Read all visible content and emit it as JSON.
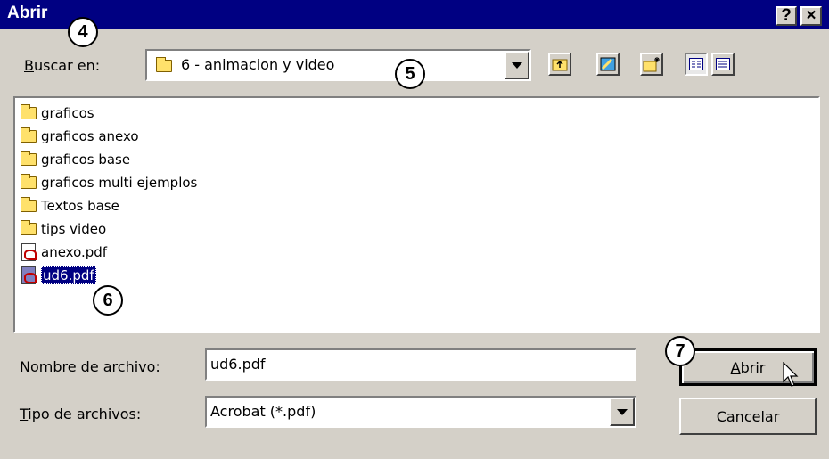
{
  "window": {
    "title": "Abrir",
    "help_label": "?",
    "close_label": "×"
  },
  "look_in": {
    "label_accel": "B",
    "label_rest": "uscar en:",
    "value": "6 - animacion y video"
  },
  "toolbar": {
    "icons": [
      "up-folder-icon",
      "desktop-icon",
      "new-folder-icon",
      "list-view-icon",
      "details-view-icon"
    ]
  },
  "files": [
    {
      "name": "graficos",
      "type": "folder",
      "selected": false
    },
    {
      "name": "graficos anexo",
      "type": "folder",
      "selected": false
    },
    {
      "name": "graficos base",
      "type": "folder",
      "selected": false
    },
    {
      "name": "graficos multi ejemplos",
      "type": "folder",
      "selected": false
    },
    {
      "name": "Textos base",
      "type": "folder",
      "selected": false
    },
    {
      "name": "tips video",
      "type": "folder",
      "selected": false
    },
    {
      "name": "anexo.pdf",
      "type": "pdf",
      "selected": false
    },
    {
      "name": "ud6.pdf",
      "type": "pdf",
      "selected": true
    }
  ],
  "filename": {
    "label_accel": "N",
    "label_rest": "ombre de archivo:",
    "value": "ud6.pdf"
  },
  "filetype": {
    "label_accel": "T",
    "label_rest": "ipo de archivos:",
    "value": "Acrobat (*.pdf)"
  },
  "buttons": {
    "open_accel": "A",
    "open_rest": "brir",
    "cancel": "Cancelar"
  },
  "markers": [
    "4",
    "5",
    "6",
    "7"
  ]
}
